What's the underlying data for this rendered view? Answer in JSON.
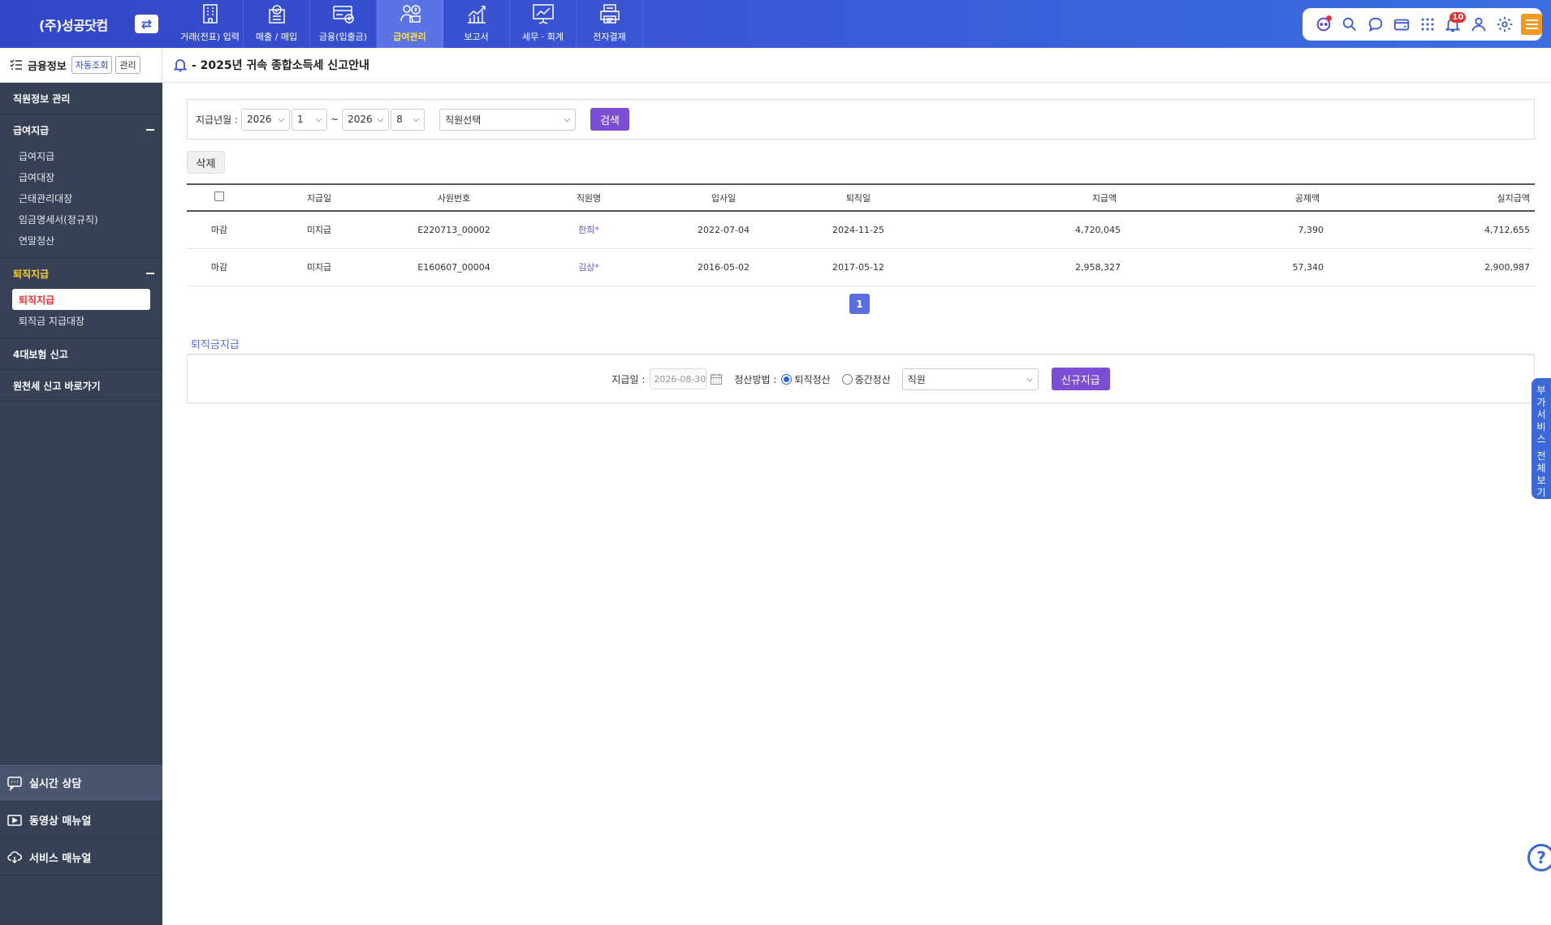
{
  "brand": {
    "name": "(주)성공닷컴"
  },
  "nav": [
    {
      "id": "transaction",
      "label": "거래(전표) 입력",
      "icon": "building-icon"
    },
    {
      "id": "sales",
      "label": "매출 / 매입",
      "icon": "checklist-icon"
    },
    {
      "id": "finance",
      "label": "금융(입출금)",
      "icon": "card-icon"
    },
    {
      "id": "payroll",
      "label": "급여관리",
      "icon": "payroll-icon",
      "active": true
    },
    {
      "id": "report",
      "label": "보고서",
      "icon": "chart-icon"
    },
    {
      "id": "tax",
      "label": "세무 · 회계",
      "icon": "presentation-icon"
    },
    {
      "id": "approval",
      "label": "전자결재",
      "icon": "printer-icon"
    }
  ],
  "util": {
    "notification_count": "10"
  },
  "sidebar": {
    "head": {
      "title": "금융정보",
      "auto_btn": "자동조회",
      "manage_btn": "관리"
    },
    "employee_info": "직원정보 관리",
    "salary": {
      "title": "급여지급",
      "items": [
        "급여지급",
        "급여대장",
        "근태관리대장",
        "임금명세서(정규직)",
        "연말정산"
      ]
    },
    "retirement": {
      "title": "퇴직지급",
      "items": [
        "퇴직지급",
        "퇴직금 지급대장"
      ]
    },
    "insurance": "4대보험 신고",
    "withholding": "원천세 신고 바로가기",
    "footer": {
      "chat": "실시간 상담",
      "video": "동영상 매뉴얼",
      "manual": "서비스 매뉴얼"
    }
  },
  "notice": {
    "text": "- 2025년 귀속 종합소득세 신고안내"
  },
  "filter": {
    "label": "지급년월 :",
    "from_year": "2026",
    "from_month": "1",
    "tilde": "~",
    "to_year": "2026",
    "to_month": "8",
    "employee_select": "직원선택",
    "search_btn": "검색"
  },
  "delete_btn": "삭제",
  "table": {
    "headers": [
      "",
      "지급일",
      "사원번호",
      "직원명",
      "입사일",
      "퇴직일",
      "지급액",
      "공제액",
      "실지급액"
    ],
    "rows": [
      {
        "status": "마감",
        "pay_date": "미지급",
        "emp_no": "E220713_00002",
        "name": "한희",
        "hire": "2022-07-04",
        "retire": "2024-11-25",
        "amount": "4,720,045",
        "deduction": "7,390",
        "net": "4,712,655"
      },
      {
        "status": "마감",
        "pay_date": "미지급",
        "emp_no": "E160607_00004",
        "name": "김상",
        "hire": "2016-05-02",
        "retire": "2017-05-12",
        "amount": "2,958,327",
        "deduction": "57,340",
        "net": "2,900,987"
      }
    ]
  },
  "pager": {
    "current": "1"
  },
  "payment": {
    "title": "퇴직금지급",
    "date_label": "지급일 :",
    "date_value": "2026-08-30",
    "method_label": "정산방법 :",
    "method_a": "퇴직정산",
    "method_b": "중간정산",
    "employee_select": "직원",
    "new_btn": "신규지급"
  },
  "side_tab": {
    "line1": [
      "부",
      "가",
      "서",
      "비",
      "스"
    ],
    "line2": [
      "전",
      "체",
      "보",
      "기"
    ]
  },
  "colors": {
    "header": "#3a57d4",
    "sidebar": "#374155",
    "accent": "#7a4fd6",
    "active_nav_text": "#ffe14d"
  }
}
